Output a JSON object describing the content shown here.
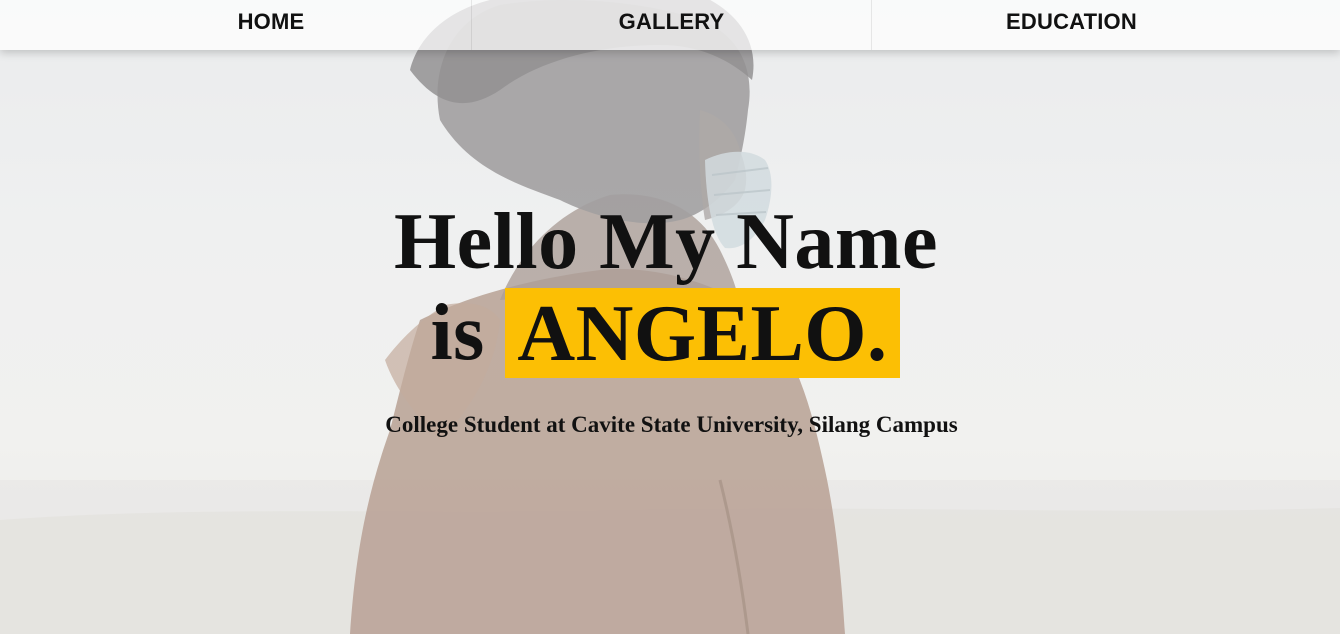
{
  "nav": {
    "items": [
      {
        "label": "HOME"
      },
      {
        "label": "GALLERY"
      },
      {
        "label": "EDUCATION"
      }
    ]
  },
  "hero": {
    "line1": "Hello My Name",
    "line2_prefix": "is",
    "name": "ANGELO.",
    "subtitle": "College Student at Cavite State University, Silang Campus",
    "highlight_color": "#fcbf04"
  }
}
